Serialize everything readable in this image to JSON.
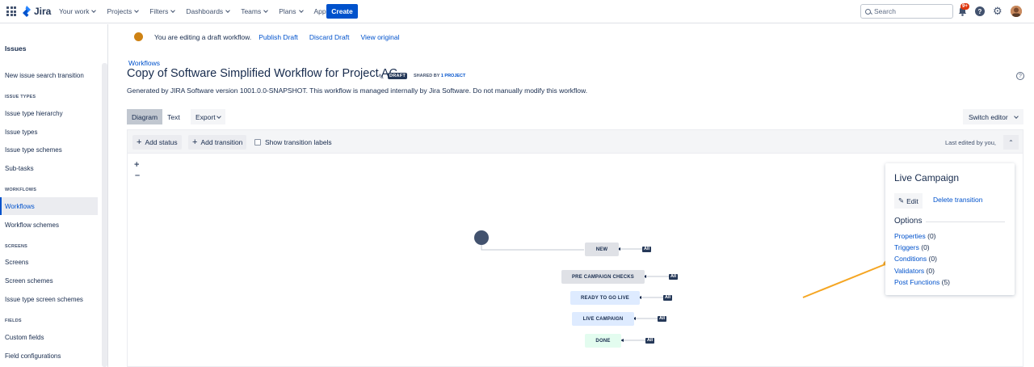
{
  "nav": {
    "logo": "Jira",
    "items": [
      "Your work",
      "Projects",
      "Filters",
      "Dashboards",
      "Teams",
      "Plans",
      "Apps"
    ],
    "create": "Create",
    "search_placeholder": "Search",
    "notif_badge": "9+"
  },
  "sidebar": {
    "title": "Issues",
    "new_issue_search": "New issue search transition",
    "sections": {
      "issue_types": "ISSUE TYPES",
      "workflows": "WORKFLOWS",
      "screens": "SCREENS",
      "fields": "FIELDS"
    },
    "items": {
      "issue_type_hierarchy": "Issue type hierarchy",
      "issue_types": "Issue types",
      "issue_type_schemes": "Issue type schemes",
      "sub_tasks": "Sub-tasks",
      "workflows": "Workflows",
      "workflow_schemes": "Workflow schemes",
      "screens": "Screens",
      "screen_schemes": "Screen schemes",
      "issue_type_screen_schemes": "Issue type screen schemes",
      "custom_fields": "Custom fields",
      "field_configurations": "Field configurations"
    }
  },
  "draft": {
    "message": "You are editing a draft workflow.",
    "publish": "Publish Draft",
    "discard": "Discard Draft",
    "view_original": "View original"
  },
  "page": {
    "breadcrumb": "Workflows",
    "title": "Copy of Software Simplified Workflow for Project AC",
    "lozenge": "DRAFT",
    "shared_prefix": "SHARED BY",
    "shared_link": "1 PROJECT",
    "generated": "Generated by JIRA Software version 1001.0.0-SNAPSHOT. This workflow is managed internally by Jira Software. Do not manually modify this workflow."
  },
  "view_tabs": {
    "diagram": "Diagram",
    "text": "Text",
    "export": "Export",
    "switch_editor": "Switch editor"
  },
  "toolbar": {
    "add_status": "Add status",
    "add_transition": "Add transition",
    "show_labels": "Show transition labels",
    "last_edited": "Last edited by you,"
  },
  "diagram": {
    "statuses": [
      {
        "name": "NEW",
        "color": "#dfe1e6"
      },
      {
        "name": "PRE CAMPAIGN CHECKS",
        "color": "#dfe1e6"
      },
      {
        "name": "READY TO GO LIVE",
        "color": "#deebff"
      },
      {
        "name": "LIVE CAMPAIGN",
        "color": "#deebff"
      },
      {
        "name": "DONE",
        "color": "#e3fcef"
      }
    ],
    "all_label": "All"
  },
  "panel": {
    "title": "Live Campaign",
    "edit": "Edit",
    "delete_transition": "Delete transition",
    "options_heading": "Options",
    "options": [
      {
        "label": "Properties",
        "count": "(0)"
      },
      {
        "label": "Triggers",
        "count": "(0)"
      },
      {
        "label": "Conditions",
        "count": "(0)"
      },
      {
        "label": "Validators",
        "count": "(0)"
      },
      {
        "label": "Post Functions",
        "count": "(5)"
      }
    ]
  },
  "colors": {
    "primary": "#0052cc",
    "arrow": "#f5a623"
  }
}
